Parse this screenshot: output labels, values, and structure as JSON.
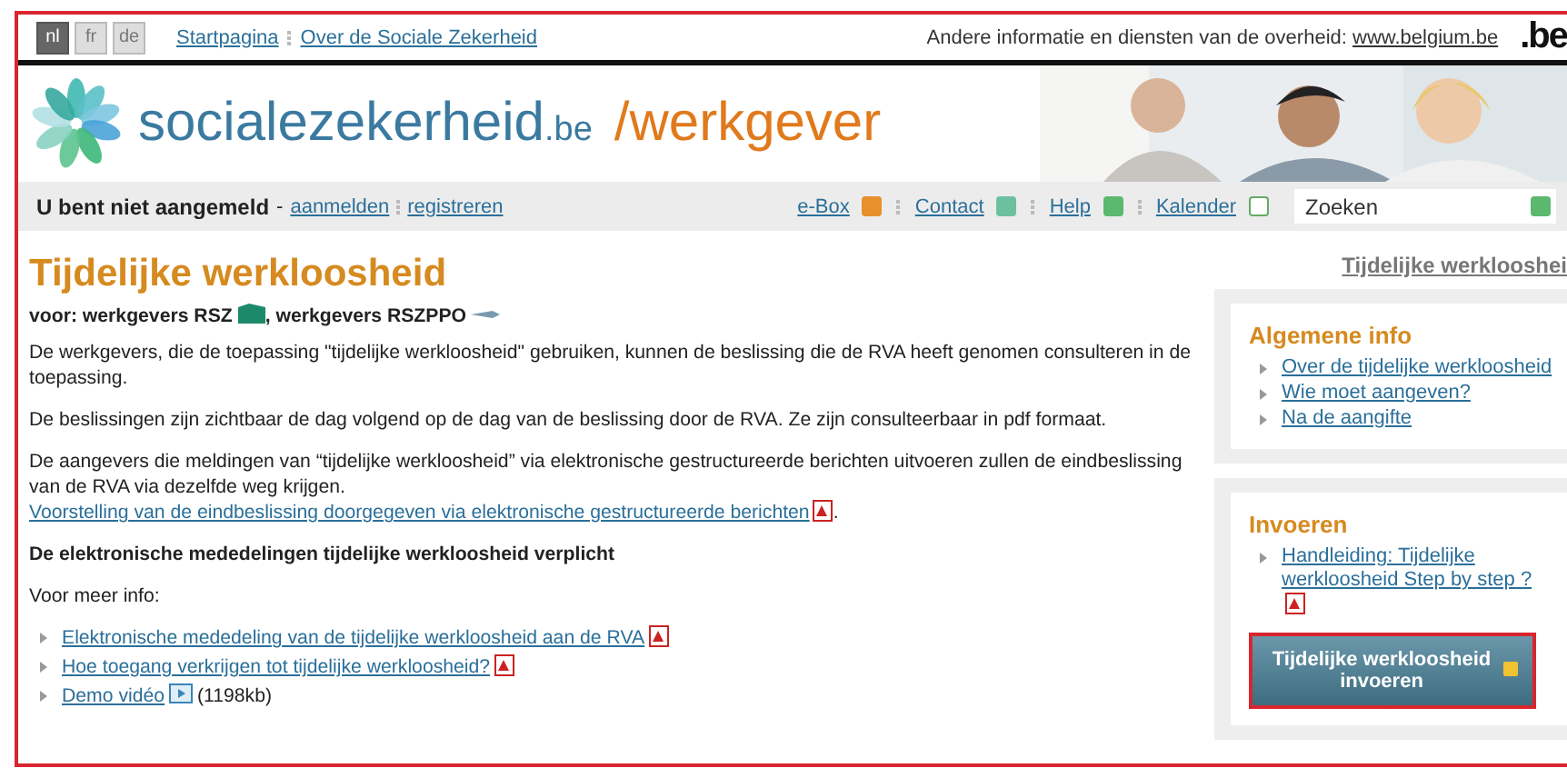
{
  "languages": [
    {
      "label": "nl",
      "selected": true
    },
    {
      "label": "fr",
      "selected": false
    },
    {
      "label": "de",
      "selected": false
    }
  ],
  "top_links": [
    "Startpagina",
    "Over de Sociale Zekerheid"
  ],
  "gov_info": {
    "text": "Andere informatie en diensten van de overheid:",
    "link": "www.belgium.be",
    "logo": ".be"
  },
  "site": {
    "name": "socialezekerheid",
    "suffix": ".be",
    "section": "/werkgever"
  },
  "login": {
    "status": "U bent niet aangemeld",
    "separator": "-",
    "links": [
      "aanmelden",
      "registreren"
    ]
  },
  "tools": [
    {
      "label": "e-Box",
      "kind": "ebox"
    },
    {
      "label": "Contact",
      "kind": "contact"
    },
    {
      "label": "Help",
      "kind": "help"
    },
    {
      "label": "Kalender",
      "kind": "calendar"
    }
  ],
  "search": {
    "placeholder": "Zoeken"
  },
  "content": {
    "title": "Tijdelijke werkloosheid",
    "audience": [
      "voor: werkgevers RSZ",
      ", werkgevers RSZPPO"
    ],
    "paragraphs": [
      "De werkgevers, die de toepassing \"tijdelijke werkloosheid\" gebruiken, kunnen de beslissing die de RVA heeft genomen consulteren in de toepassing.",
      "De beslissingen zijn zichtbaar de dag volgend op de dag van de beslissing door de RVA. Ze zijn consulteerbaar in pdf formaat.",
      "De aangevers die meldingen van “tijdelijke werkloosheid” via elektronische gestructureerde berichten uitvoeren zullen de eindbeslissing van de RVA via dezelfde weg krijgen."
    ],
    "presentation_link": "Voorstelling van de eindbeslissing doorgegeven via elektronische gestructureerde berichten",
    "presentation_end": ".",
    "heading": "De elektronische mededelingen tijdelijke werkloosheid verplicht",
    "more_info": "Voor meer info:",
    "links": [
      {
        "label": "Elektronische mededeling van de tijdelijke werkloosheid aan de RVA",
        "kind": "pdf"
      },
      {
        "label": "Hoe toegang verkrijgen tot tijdelijke werkloosheid?",
        "kind": "pdf"
      },
      {
        "label": "Demo vidéo",
        "kind": "video",
        "size": "(1198kb)"
      }
    ]
  },
  "sidebar": {
    "breadcrumb": "Tijdelijke werklooshei",
    "boxes": [
      {
        "title": "Algemene info",
        "links": [
          {
            "label": "Over de tijdelijke werkloosheid",
            "kind": "plain"
          },
          {
            "label": "Wie moet aangeven?",
            "kind": "plain"
          },
          {
            "label": "Na de aangifte",
            "kind": "plain"
          }
        ]
      },
      {
        "title": "Invoeren",
        "links": [
          {
            "label": "Handleiding: Tijdelijke werkloosheid Step by step ?",
            "kind": "pdf"
          }
        ],
        "button": "Tijdelijke werkloosheid invoeren"
      }
    ]
  }
}
